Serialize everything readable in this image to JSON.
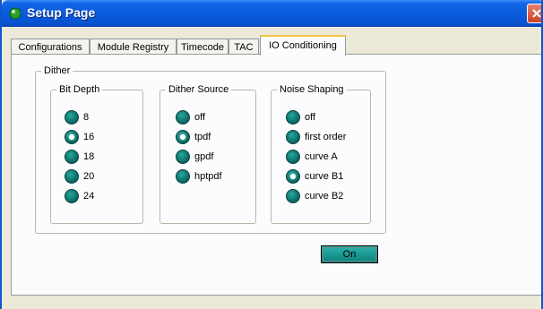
{
  "window": {
    "title": "Setup Page",
    "titlebar_color": "#0a5bdc"
  },
  "tabs": [
    {
      "label": "Configurations",
      "active": false
    },
    {
      "label": "Module Registry",
      "active": false
    },
    {
      "label": "Timecode",
      "active": false
    },
    {
      "label": "TAC",
      "active": false
    },
    {
      "label": "IO Conditioning",
      "active": true
    }
  ],
  "dither": {
    "label": "Dither",
    "bit_depth": {
      "label": "Bit Depth",
      "options": [
        "8",
        "16",
        "18",
        "20",
        "24"
      ],
      "selected": "16"
    },
    "dither_source": {
      "label": "Dither Source",
      "options": [
        "off",
        "tpdf",
        "gpdf",
        "hptpdf"
      ],
      "selected": "tpdf"
    },
    "noise_shaping": {
      "label": "Noise Shaping",
      "options": [
        "off",
        "first order",
        "curve A",
        "curve B1",
        "curve B2"
      ],
      "selected": "curve B1"
    },
    "on_button": "On",
    "radio_color": "#0b6f6a"
  }
}
